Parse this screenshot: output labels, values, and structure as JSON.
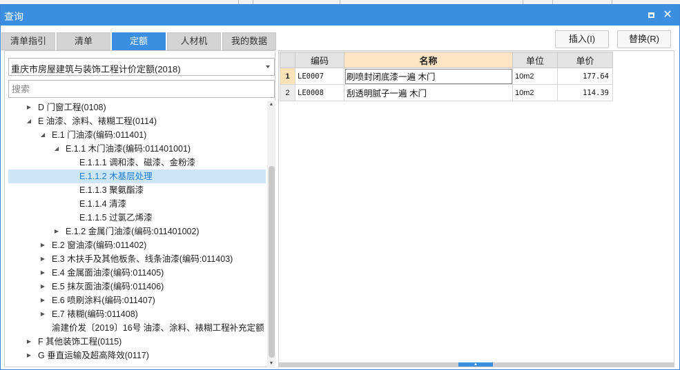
{
  "window": {
    "title": "查询",
    "controls": {
      "maximize_icon": "maximize-icon",
      "close_icon": "close-icon",
      "close_label": "✕"
    }
  },
  "tabs": [
    {
      "label": "清单指引",
      "active": false
    },
    {
      "label": "清单",
      "active": false
    },
    {
      "label": "定额",
      "active": true
    },
    {
      "label": "人材机",
      "active": false
    },
    {
      "label": "我的数据",
      "active": false
    }
  ],
  "actions": {
    "insert_label": "插入(I)",
    "replace_label": "替换(R)"
  },
  "library": {
    "selected": "重庆市房屋建筑与装饰工程计价定额(2018)"
  },
  "search": {
    "placeholder": "搜索",
    "value": ""
  },
  "tree": [
    {
      "label": "D 门窗工程(0108)",
      "toggle": "collapsed",
      "level": 1
    },
    {
      "label": "E 油漆、涂料、裱糊工程(0114)",
      "toggle": "expanded",
      "level": 1
    },
    {
      "label": "E.1 门油漆(编码:011401)",
      "toggle": "expanded",
      "level": 2
    },
    {
      "label": "E.1.1 木门油漆(编码:011401001)",
      "toggle": "expanded",
      "level": 3
    },
    {
      "label": "E.1.1.1 调和漆、磁漆、金粉漆",
      "toggle": "none",
      "level": 4
    },
    {
      "label": "E.1.1.2 木基层处理",
      "toggle": "none",
      "level": 4,
      "selected": true
    },
    {
      "label": "E.1.1.3 聚氨酯漆",
      "toggle": "none",
      "level": 4
    },
    {
      "label": "E.1.1.4 清漆",
      "toggle": "none",
      "level": 4
    },
    {
      "label": "E.1.1.5 过氯乙烯漆",
      "toggle": "none",
      "level": 4
    },
    {
      "label": "E.1.2 金属门油漆(编码:011401002)",
      "toggle": "collapsed",
      "level": 3
    },
    {
      "label": "E.2 窗油漆(编码:011402)",
      "toggle": "collapsed",
      "level": 2
    },
    {
      "label": "E.3 木扶手及其他板条、线条油漆(编码:011403)",
      "toggle": "collapsed",
      "level": 2
    },
    {
      "label": "E.4 金属面油漆(编码:011405)",
      "toggle": "collapsed",
      "level": 2
    },
    {
      "label": "E.5 抹灰面油漆(编码:011406)",
      "toggle": "collapsed",
      "level": 2
    },
    {
      "label": "E.6 喷刷涂料(编码:011407)",
      "toggle": "collapsed",
      "level": 2
    },
    {
      "label": "E.7 裱糊(编码:011408)",
      "toggle": "collapsed",
      "level": 2
    },
    {
      "label": "渝建价发〔2019〕16号 油漆、涂料、裱糊工程补充定额",
      "toggle": "none",
      "level": 2
    },
    {
      "label": "F 其他装饰工程(0115)",
      "toggle": "collapsed",
      "level": 1
    },
    {
      "label": "G 垂直运输及超高降效(0117)",
      "toggle": "collapsed",
      "level": 1
    }
  ],
  "grid": {
    "columns": {
      "code": "编码",
      "name": "名称",
      "unit": "单位",
      "price": "单价"
    },
    "rows": [
      {
        "num": "1",
        "code": "LE0007",
        "name": "刷喷封闭底漆一遍 木门",
        "unit": "10m2",
        "price": "177.64",
        "selected": true
      },
      {
        "num": "2",
        "code": "LE0008",
        "name": "刮透明腻子一遍 木门",
        "unit": "10m2",
        "price": "114.39",
        "selected": false
      }
    ]
  },
  "colors": {
    "accent": "#3c8fe0",
    "selection": "#cde6f7",
    "name_header": "#fce4c4"
  }
}
